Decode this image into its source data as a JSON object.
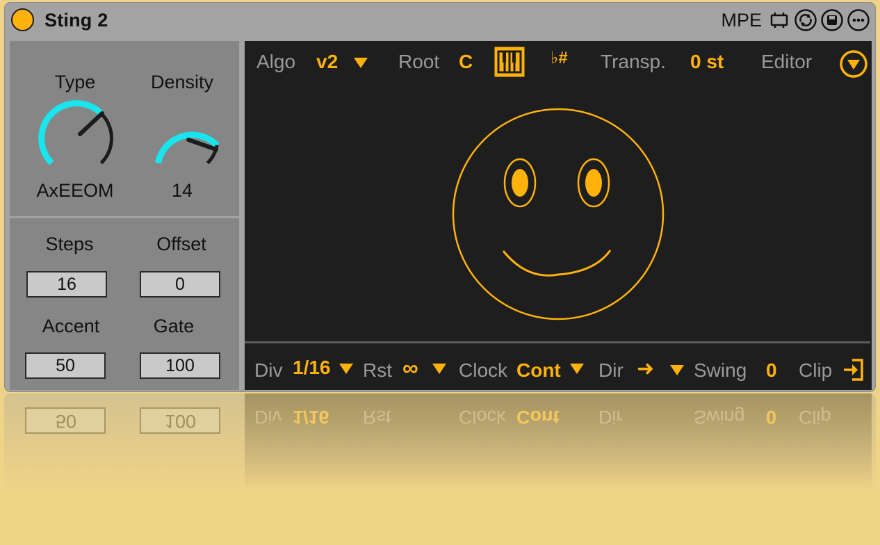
{
  "title_bar": {
    "device_name": "Sting 2",
    "mpe_label": "MPE"
  },
  "knobs": {
    "type": {
      "label": "Type",
      "value": "AxEEOM"
    },
    "density": {
      "label": "Density",
      "value": "14"
    }
  },
  "params": {
    "steps": {
      "label": "Steps",
      "value": "16"
    },
    "offset": {
      "label": "Offset",
      "value": "0"
    },
    "accent": {
      "label": "Accent",
      "value": "50"
    },
    "gate": {
      "label": "Gate",
      "value": "100"
    }
  },
  "top_bar": {
    "algo_label": "Algo",
    "algo_value": "v2",
    "root_label": "Root",
    "root_value": "C",
    "accidental_label": "♭#",
    "transp_label": "Transp.",
    "transp_value": "0 st",
    "editor_label": "Editor"
  },
  "bottom_bar": {
    "div_label": "Div",
    "div_value": "1/16",
    "rst_label": "Rst",
    "rst_value": "∞",
    "clock_label": "Clock",
    "clock_value": "Cont",
    "dir_label": "Dir",
    "dir_value": "➜",
    "swing_label": "Swing",
    "swing_value": "0",
    "clip_label": "Clip"
  },
  "colors": {
    "accent": "#ffb20c",
    "knob_arc": "#19e5ee",
    "background": "#efd386",
    "display_bg": "#1e1e1e",
    "panel": "#868686"
  }
}
